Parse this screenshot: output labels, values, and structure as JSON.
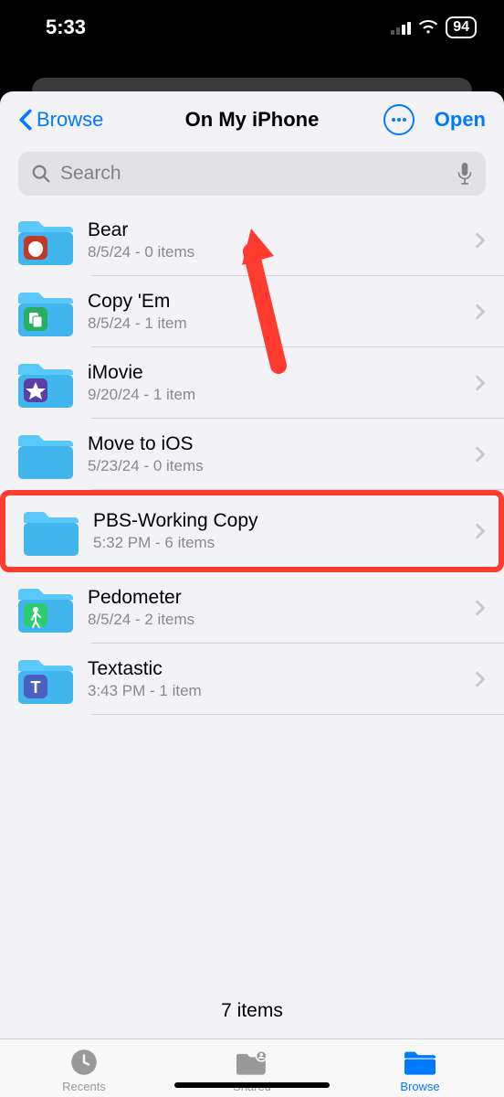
{
  "status_bar": {
    "time": "5:33",
    "battery": "94"
  },
  "nav": {
    "back_label": "Browse",
    "title": "On My iPhone",
    "open_label": "Open"
  },
  "search": {
    "placeholder": "Search"
  },
  "folders": [
    {
      "name": "Bear",
      "subtitle": "8/5/24 - 0 items",
      "icon": "bear"
    },
    {
      "name": "Copy 'Em",
      "subtitle": "8/5/24 - 1 item",
      "icon": "copyem"
    },
    {
      "name": "iMovie",
      "subtitle": "9/20/24 - 1 item",
      "icon": "imovie"
    },
    {
      "name": "Move to iOS",
      "subtitle": "5/23/24 - 0 items",
      "icon": "plain"
    },
    {
      "name": "PBS-Working Copy",
      "subtitle": "5:32 PM - 6 items",
      "icon": "plain"
    },
    {
      "name": "Pedometer",
      "subtitle": "8/5/24 - 2 items",
      "icon": "pedo"
    },
    {
      "name": "Textastic",
      "subtitle": "3:43 PM - 1 item",
      "icon": "text"
    }
  ],
  "highlighted_index": 4,
  "footer": {
    "count": "7 items"
  },
  "tabs": {
    "recents": "Recents",
    "shared": "Shared",
    "browse": "Browse"
  }
}
